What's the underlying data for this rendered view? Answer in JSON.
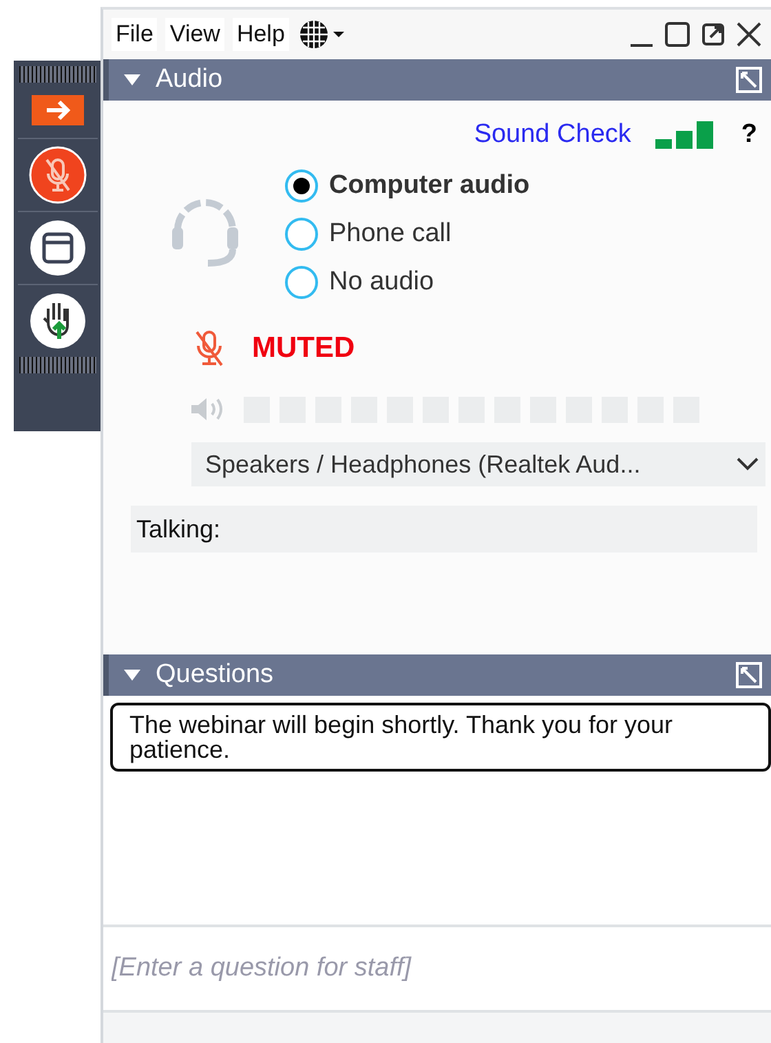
{
  "menu": [
    "File",
    "View",
    "Help"
  ],
  "audio": {
    "title": "Audio",
    "sound_check": "Sound Check",
    "help": "?",
    "options": [
      {
        "label": "Computer audio",
        "selected": true
      },
      {
        "label": "Phone call",
        "selected": false
      },
      {
        "label": "No audio",
        "selected": false
      }
    ],
    "muted": true,
    "muted_label": "MUTED",
    "speaker": "Speakers / Headphones (Realtek Aud...",
    "talking": "Talking:"
  },
  "questions": {
    "title": "Questions",
    "message": "The webinar will begin shortly.  Thank you for your patience.",
    "placeholder": "[Enter a question for staff]"
  }
}
